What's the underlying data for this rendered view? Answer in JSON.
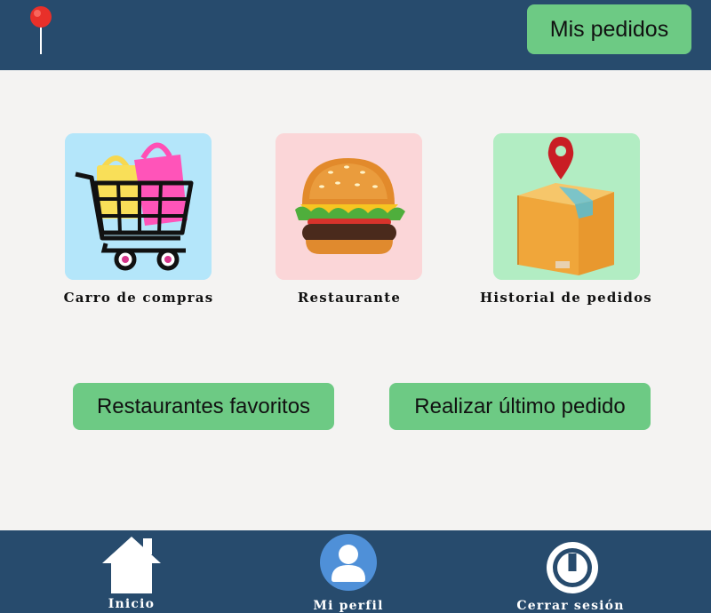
{
  "header": {
    "location_icon": "map-pin-icon",
    "orders_label": "Mis pedidos",
    "colors": {
      "bar": "#274b6d",
      "button": "#6dca84"
    }
  },
  "tiles": [
    {
      "label": "Carro de compras",
      "icon": "shopping-cart-icon",
      "bg": "#b4e6fa"
    },
    {
      "label": "Restaurante",
      "icon": "burger-icon",
      "bg": "#fbd6d8"
    },
    {
      "label": "Historial de pedidos",
      "icon": "package-location-icon",
      "bg": "#b2edc3"
    }
  ],
  "actions": {
    "favorites_label": "Restaurantes favoritos",
    "reorder_label": "Realizar último pedido"
  },
  "bottom_nav": [
    {
      "label": "Inicio",
      "icon": "home-icon"
    },
    {
      "label": "Mi perfil",
      "icon": "user-icon"
    },
    {
      "label": "Cerrar sesión",
      "icon": "power-icon"
    }
  ]
}
